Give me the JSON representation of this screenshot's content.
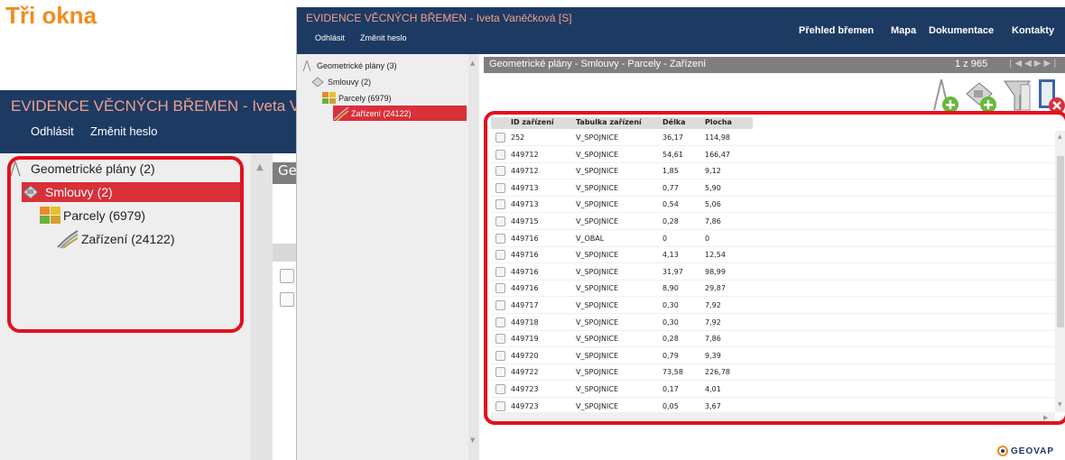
{
  "slide_title": "Tři okna",
  "app": {
    "title": "EVIDENCE VĚCNÝCH BŘEMEN - Iveta Vaněčková [S]",
    "title_short": "EVIDENCE VĚCNÝCH BŘEMEN - Iveta Vaně",
    "logout": "Odhlásit",
    "change_password": "Změnit heslo",
    "nav": [
      "Přehled břemen",
      "Mapa",
      "Dokumentace",
      "Kontakty"
    ]
  },
  "tree": {
    "nodes": [
      {
        "label": "Geometrické plány (3)",
        "icon": "survey-instrument-icon"
      },
      {
        "label": "Smlouvy (2)",
        "icon": "contract-stamp-icon"
      },
      {
        "label": "Parcely (6979)",
        "icon": "parcels-icon"
      },
      {
        "label": "Zařízení (24122)",
        "icon": "device-icon"
      }
    ]
  },
  "tree_zoom": {
    "nodes": [
      {
        "label": "Geometrické plány (2)"
      },
      {
        "label": "Smlouvy (2)"
      },
      {
        "label": "Parcely (6979)"
      },
      {
        "label": "Zařízení (24122)"
      }
    ],
    "main_title_fragment": "Ge"
  },
  "panel": {
    "breadcrumb": "Geometrické plány - Smlouvy - Parcely - Zařízení",
    "page_info": "1 z 965",
    "pager_icons": [
      "first-page-icon",
      "prev-page-icon",
      "next-page-icon",
      "last-page-icon"
    ]
  },
  "toolbar": {
    "icons": [
      "add-survey-icon",
      "add-contract-icon",
      "filter-icon",
      "delete-icon"
    ]
  },
  "grid": {
    "columns": [
      "ID zařízení",
      "Tabulka zařízení",
      "Délka",
      "Plocha"
    ],
    "rows": [
      [
        "252",
        "V_SPOJNICE",
        "36,17",
        "114,98"
      ],
      [
        "449712",
        "V_SPOJNICE",
        "54,61",
        "166,47"
      ],
      [
        "449712",
        "V_SPOJNICE",
        "1,85",
        "9,12"
      ],
      [
        "449713",
        "V_SPOJNICE",
        "0,77",
        "5,90"
      ],
      [
        "449713",
        "V_SPOJNICE",
        "0,54",
        "5,06"
      ],
      [
        "449715",
        "V_SPOJNICE",
        "0,28",
        "7,86"
      ],
      [
        "449716",
        "V_OBAL",
        "0",
        "0"
      ],
      [
        "449716",
        "V_SPOJNICE",
        "4,13",
        "12,54"
      ],
      [
        "449716",
        "V_SPOJNICE",
        "31,97",
        "98,99"
      ],
      [
        "449716",
        "V_SPOJNICE",
        "8,90",
        "29,87"
      ],
      [
        "449717",
        "V_SPOJNICE",
        "0,30",
        "7,92"
      ],
      [
        "449718",
        "V_SPOJNICE",
        "0,30",
        "7,92"
      ],
      [
        "449719",
        "V_SPOJNICE",
        "0,28",
        "7,86"
      ],
      [
        "449720",
        "V_SPOJNICE",
        "0,79",
        "9,39"
      ],
      [
        "449722",
        "V_SPOJNICE",
        "73,58",
        "226,78"
      ],
      [
        "449723",
        "V_SPOJNICE",
        "0,17",
        "4,01"
      ],
      [
        "449723",
        "V_SPOJNICE",
        "0,05",
        "3,67"
      ]
    ]
  },
  "logo": "GEOVAP",
  "colors": {
    "header_bg": "#1d3a63",
    "title_text": "#f1a08e",
    "selection": "#d9303a",
    "highlight_frame": "#e3101c",
    "slide_title": "#f28c1c"
  }
}
